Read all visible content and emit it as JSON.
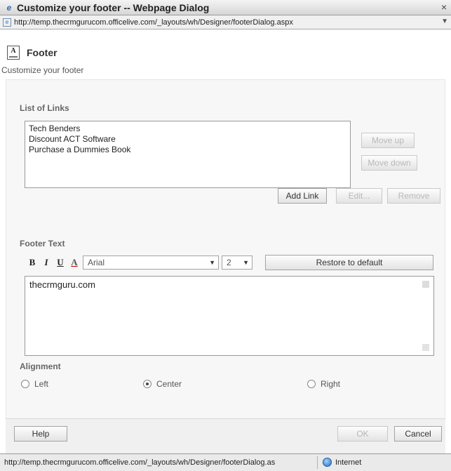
{
  "window": {
    "title": "Customize your footer -- Webpage Dialog",
    "close_glyph": "×",
    "url": "http://temp.thecrmgurucom.officelive.com/_layouts/wh/Designer/footerDialog.aspx"
  },
  "header": {
    "icon_label": "A",
    "title": "Footer",
    "subtitle": "Customize your footer"
  },
  "links_section": {
    "label": "List of Links",
    "items": [
      {
        "label": "Tech Benders"
      },
      {
        "label": "Discount ACT Software"
      },
      {
        "label": "Purchase a Dummies Book"
      }
    ],
    "move_up": "Move up",
    "move_down": "Move down",
    "add_link": "Add Link",
    "edit": "Edit...",
    "remove": "Remove"
  },
  "footer_text_section": {
    "label": "Footer Text",
    "bold": "B",
    "italic": "I",
    "underline": "U",
    "font_color": "A",
    "font_name": "Arial",
    "font_size": "2",
    "restore_default": "Restore to default",
    "editor_text": "thecrmguru.com"
  },
  "alignment_section": {
    "label": "Alignment",
    "options": [
      {
        "label": "Left",
        "checked": false
      },
      {
        "label": "Center",
        "checked": true
      },
      {
        "label": "Right",
        "checked": false
      }
    ]
  },
  "footer_buttons": {
    "help": "Help",
    "ok": "OK",
    "cancel": "Cancel"
  },
  "statusbar": {
    "url": "http://temp.thecrmgurucom.officelive.com/_layouts/wh/Designer/footerDialog.as",
    "zone": "Internet"
  },
  "colors": {
    "panel_bg": "#f7f7f7",
    "disabled_text": "#b8b8b8"
  }
}
